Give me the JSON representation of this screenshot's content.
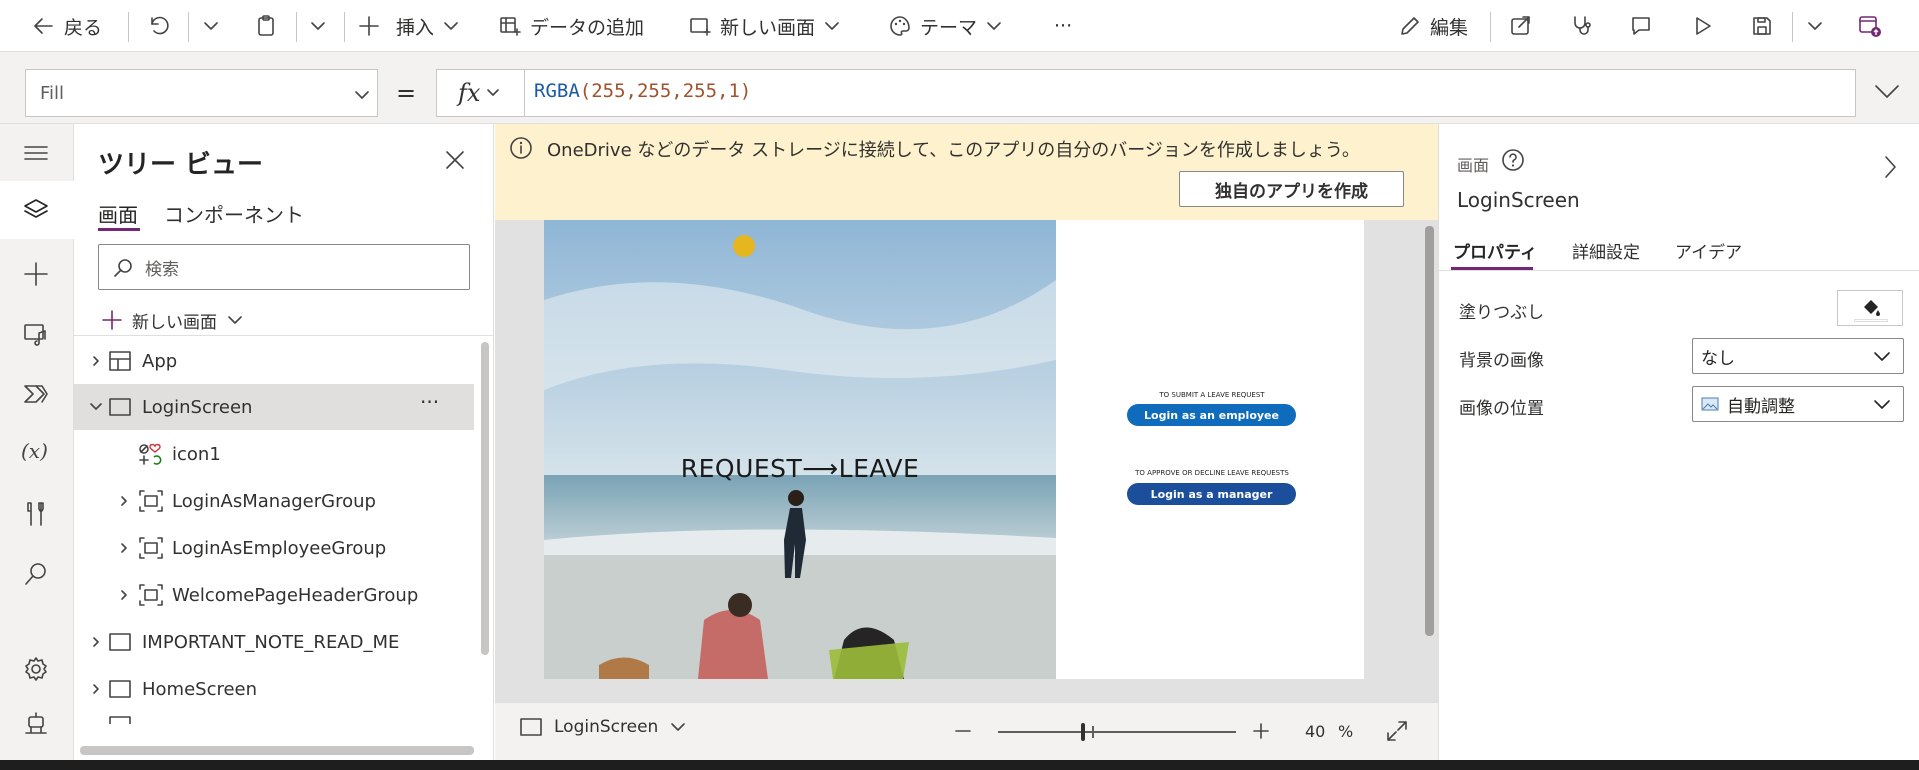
{
  "toolbar": {
    "back_label": "戻る",
    "insert_label": "挿入",
    "add_data_label": "データの追加",
    "new_screen_label": "新しい画面",
    "theme_label": "テーマ",
    "more_label": "···",
    "edit_label": "編集"
  },
  "formula_bar": {
    "property": "Fill",
    "equals": "=",
    "fx": "fx",
    "formula_func": "RGBA",
    "formula_args": "(255,255,255,1)"
  },
  "tree_view": {
    "title": "ツリー ビュー",
    "tabs": [
      "画面",
      "コンポーネント"
    ],
    "search_placeholder": "検索",
    "new_screen_label": "新しい画面",
    "items": [
      {
        "label": "App"
      },
      {
        "label": "LoginScreen",
        "more": "···"
      },
      {
        "label": "icon1"
      },
      {
        "label": "LoginAsManagerGroup"
      },
      {
        "label": "LoginAsEmployeeGroup"
      },
      {
        "label": "WelcomePageHeaderGroup"
      },
      {
        "label": "IMPORTANT_NOTE_READ_ME"
      },
      {
        "label": "HomeScreen"
      }
    ]
  },
  "banner": {
    "text": "OneDrive などのデータ ストレージに接続して、このアプリの自分のバージョンを作成しましょう。",
    "button_label": "独自のアプリを作成"
  },
  "preview": {
    "headline": "REQUEST⟶LEAVE",
    "submit_caption": "TO SUBMIT A LEAVE REQUEST",
    "employee_button": "Login as an employee",
    "approve_caption": "TO APPROVE OR DECLINE LEAVE REQUESTS",
    "manager_button": "Login as a manager"
  },
  "bottom_bar": {
    "screen_label": "LoginScreen",
    "zoom_value": "40",
    "zoom_unit": "%"
  },
  "zoom_level": 0.4,
  "properties": {
    "section_label": "画面",
    "screen_name": "LoginScreen",
    "tabs": [
      "プロパティ",
      "詳細設定",
      "アイデア"
    ],
    "fill_label": "塗りつぶし",
    "bg_image_label": "背景の画像",
    "bg_image_value": "なし",
    "image_position_label": "画像の位置",
    "image_position_value": "自動調整"
  },
  "colors": {
    "accent": "#742774",
    "banner_bg": "#fdf2cd",
    "button_blue": "#0f6cbd",
    "manager_blue": "#1b4f9c"
  }
}
